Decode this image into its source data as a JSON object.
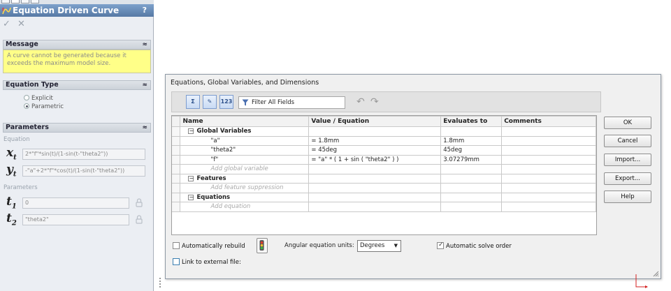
{
  "property_manager": {
    "title": "Equation Driven Curve",
    "help": "?",
    "ok_icon": "checkmark-icon",
    "cancel_icon": "close-icon",
    "message": {
      "header": "Message",
      "text_line1": "A curve cannot be generated because it",
      "text_line2": "exceeds the maximum model size."
    },
    "equation_type": {
      "header": "Equation Type",
      "options": [
        "Explicit",
        "Parametric"
      ],
      "selected": "Parametric"
    },
    "parameters": {
      "header": "Parameters",
      "equation_label": "Equation",
      "xt_symbol": "x",
      "yt_symbol": "y",
      "sub_t": "t",
      "xt_value": "2*\"f\"*sin(t)/(1-sin(t-\"theta2\"))",
      "yt_value": "-\"a\"+2*\"f\"*cos(t)/(1-sin(t-\"theta2\"))",
      "params_label": "Parameters",
      "t1_symbol": "t",
      "t1_sub": "1",
      "t1_value": "0",
      "t2_symbol": "t",
      "t2_sub": "2",
      "t2_value": "\"theta2\""
    }
  },
  "dialog": {
    "title": "Equations, Global Variables, and Dimensions",
    "filter_placeholder": "Filter All Fields",
    "columns": [
      "Name",
      "Value / Equation",
      "Evaluates to",
      "Comments"
    ],
    "groups": {
      "global_variables": "Global Variables",
      "features": "Features",
      "equations": "Equations"
    },
    "rows": [
      {
        "name": "\"a\"",
        "value": "= 1.8mm",
        "evaluates": "1.8mm",
        "comments": ""
      },
      {
        "name": "\"theta2\"",
        "value": "= 45deg",
        "evaluates": "45deg",
        "comments": ""
      },
      {
        "name": "\"f\"",
        "value": "= \"a\" * ( 1 + sin ( \"theta2\" ) )",
        "evaluates": "3.07279mm",
        "comments": ""
      }
    ],
    "placeholders": {
      "add_global": "Add global variable",
      "add_feature": "Add feature suppression",
      "add_equation": "Add equation"
    },
    "buttons": {
      "ok": "OK",
      "cancel": "Cancel",
      "import": "Import...",
      "export": "Export...",
      "help": "Help"
    },
    "auto_rebuild": "Automatically rebuild",
    "angular_units_label": "Angular equation units:",
    "angular_units_value": "Degrees",
    "auto_solve": "Automatic solve order",
    "link_external": "Link to external file:",
    "auto_rebuild_checked": false,
    "auto_solve_checked": true,
    "link_external_checked": false
  },
  "colors": {
    "title_bar": "#5679a5",
    "message_bg": "#ffff88",
    "axis_red": "#d42020"
  }
}
